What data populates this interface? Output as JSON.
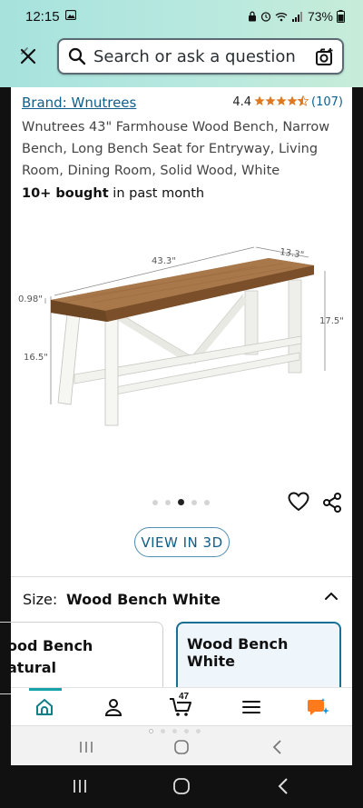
{
  "status_bar": {
    "time": "12:15",
    "battery": "73%"
  },
  "search": {
    "placeholder": "Search or ask a question"
  },
  "product": {
    "brand": "Brand: Wnutrees",
    "rating_value": "4.4",
    "rating_stars": 4.5,
    "rating_count": "(107)",
    "title": "Wnutrees 43\" Farmhouse Wood Bench, Narrow Bench, Long Bench Seat for Entryway, Living Room, Dining Room, Solid Wood, White",
    "bought_bold": "10+ bought",
    "bought_rest": " in past month",
    "image": {
      "dim_length": "43.3\"",
      "dim_depth": "13.3\"",
      "dim_top": "0.98\"",
      "dim_height": "17.5\"",
      "dim_leg": "16.5\""
    },
    "image_count": 5,
    "image_index": 3,
    "view_3d_label": "VIEW IN 3D"
  },
  "size": {
    "label": "Size:",
    "value": "Wood Bench White",
    "options": [
      {
        "label": "Wood Bench Natural",
        "visible_text_line1": "ood Bench",
        "visible_text_line2": "atural",
        "selected": false
      },
      {
        "label": "Wood Bench White",
        "selected": true
      }
    ]
  },
  "bottom_nav": {
    "items": [
      {
        "name": "home",
        "icon": "home-icon",
        "active": true
      },
      {
        "name": "account",
        "icon": "person-icon"
      },
      {
        "name": "cart",
        "icon": "cart-icon",
        "count": "47"
      },
      {
        "name": "menu",
        "icon": "menu-icon"
      },
      {
        "name": "rufus",
        "icon": "chat-sparkle-icon"
      }
    ]
  },
  "colors": {
    "header_gradient_start": "#a7e2dd",
    "link": "#0f5e8a",
    "accent_teal": "#15a2a8",
    "star": "#de7921",
    "selected_border": "#1a6f94",
    "wood_top": "#9a6a3d",
    "bench_legs": "#f4f4f0"
  }
}
